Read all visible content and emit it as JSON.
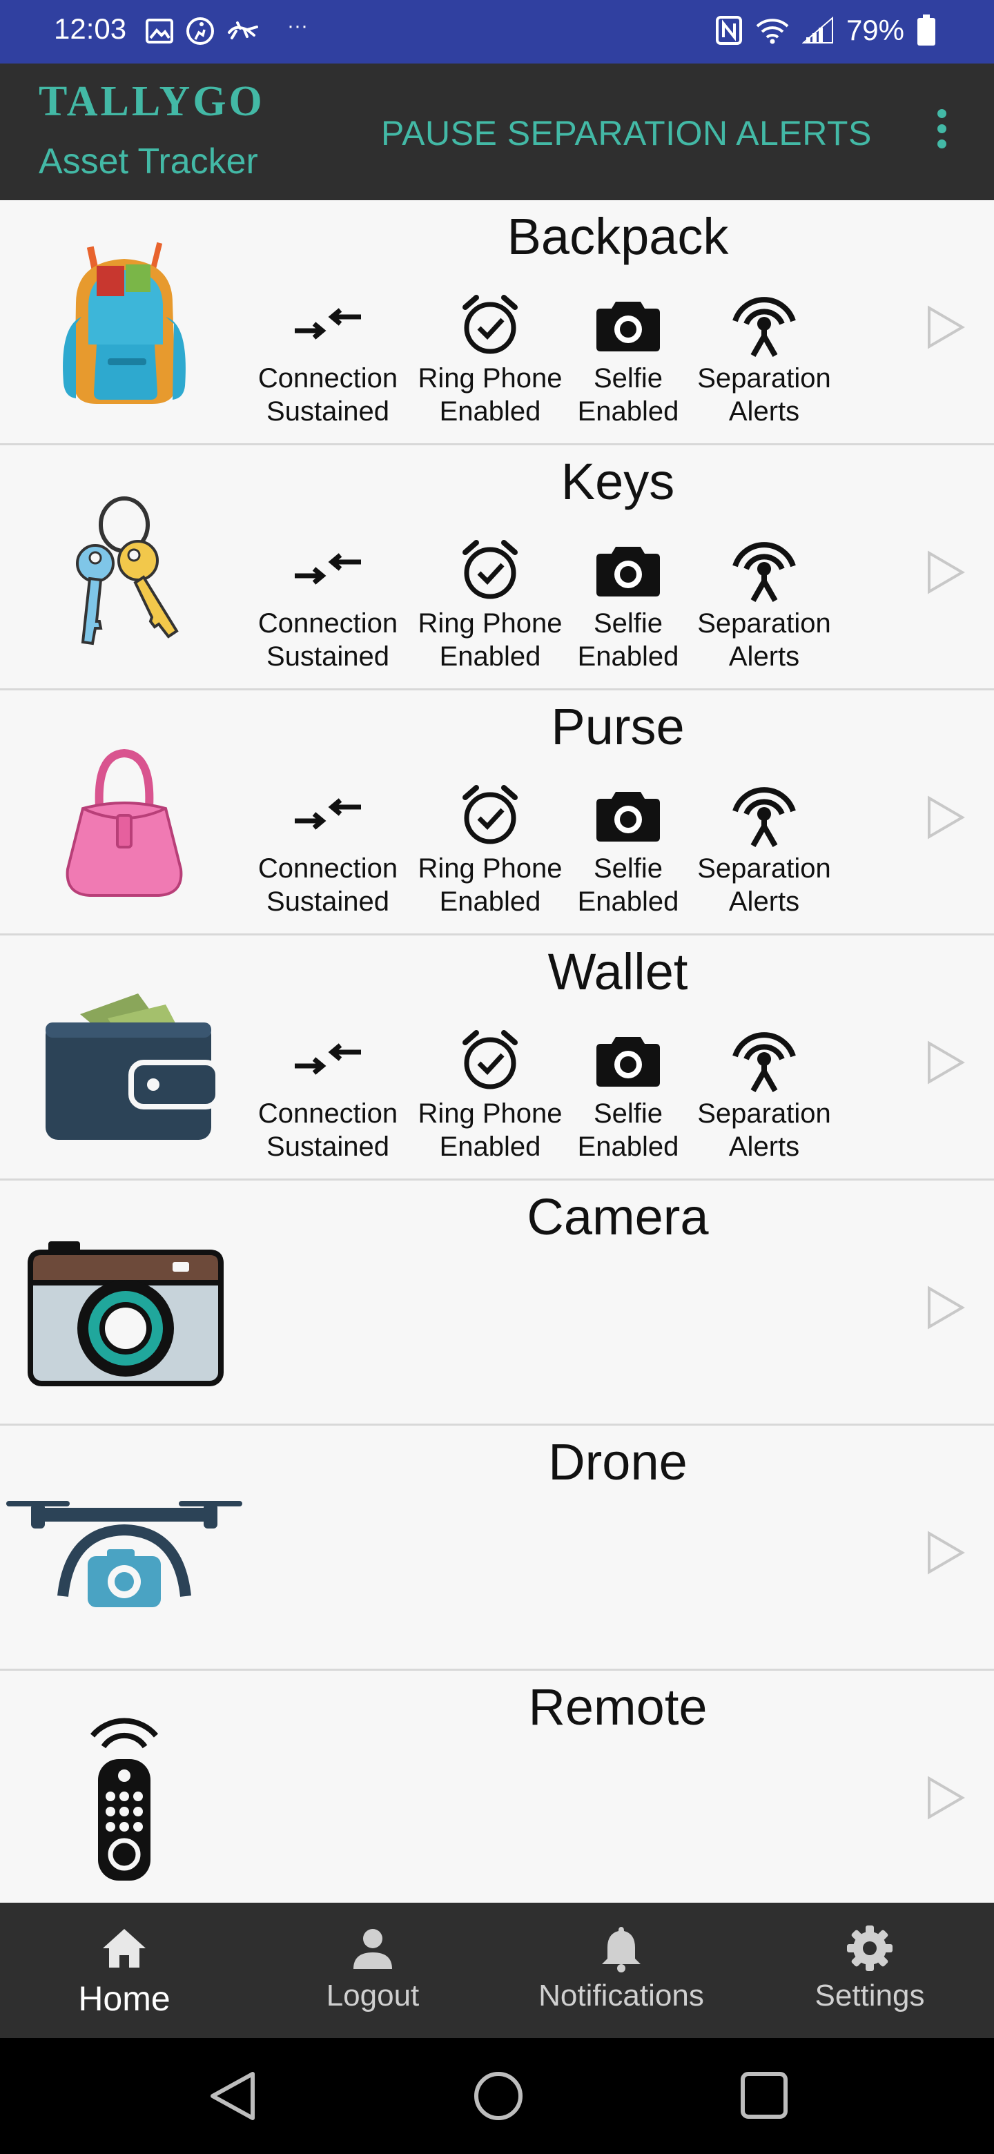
{
  "status_bar": {
    "time": "12:03",
    "more_notifications": "···",
    "battery_percent": "79%"
  },
  "app_bar": {
    "brand_title": "TALLYGO",
    "brand_subtitle": "Asset Tracker",
    "pause_action": "PAUSE SEPARATION ALERTS"
  },
  "colors": {
    "status_bar": "#3040a0",
    "app_bar": "#2f2f2f",
    "accent": "#43b9a6",
    "list_background": "#f7f7f7"
  },
  "assets": [
    {
      "name": "Backpack",
      "image_icon": "backpack-icon",
      "features": [
        {
          "icon": "connection-icon",
          "label": "Connection\nSustained"
        },
        {
          "icon": "alarm-clock-icon",
          "label": "Ring Phone\nEnabled"
        },
        {
          "icon": "camera-icon",
          "label": "Selfie\nEnabled"
        },
        {
          "icon": "antenna-icon",
          "label": "Separation\nAlerts"
        }
      ]
    },
    {
      "name": "Keys",
      "image_icon": "keys-icon",
      "features": [
        {
          "icon": "connection-icon",
          "label": "Connection\nSustained"
        },
        {
          "icon": "alarm-clock-icon",
          "label": "Ring Phone\nEnabled"
        },
        {
          "icon": "camera-icon",
          "label": "Selfie\nEnabled"
        },
        {
          "icon": "antenna-icon",
          "label": "Separation\nAlerts"
        }
      ]
    },
    {
      "name": "Purse",
      "image_icon": "purse-icon",
      "features": [
        {
          "icon": "connection-icon",
          "label": "Connection\nSustained"
        },
        {
          "icon": "alarm-clock-icon",
          "label": "Ring Phone\nEnabled"
        },
        {
          "icon": "camera-icon",
          "label": "Selfie\nEnabled"
        },
        {
          "icon": "antenna-icon",
          "label": "Separation\nAlerts"
        }
      ]
    },
    {
      "name": "Wallet",
      "image_icon": "wallet-icon",
      "features": [
        {
          "icon": "connection-icon",
          "label": "Connection\nSustained"
        },
        {
          "icon": "alarm-clock-icon",
          "label": "Ring Phone\nEnabled"
        },
        {
          "icon": "camera-icon",
          "label": "Selfie\nEnabled"
        },
        {
          "icon": "antenna-icon",
          "label": "Separation\nAlerts"
        }
      ]
    },
    {
      "name": "Camera",
      "image_icon": "camera-device-icon",
      "features": []
    },
    {
      "name": "Drone",
      "image_icon": "drone-icon",
      "features": []
    },
    {
      "name": "Remote",
      "image_icon": "remote-icon",
      "features": []
    }
  ],
  "bottom_nav": [
    {
      "label": "Home",
      "icon": "home-icon",
      "active": true
    },
    {
      "label": "Logout",
      "icon": "person-icon",
      "active": false
    },
    {
      "label": "Notifications",
      "icon": "bell-icon",
      "active": false
    },
    {
      "label": "Settings",
      "icon": "gear-icon",
      "active": false
    }
  ]
}
